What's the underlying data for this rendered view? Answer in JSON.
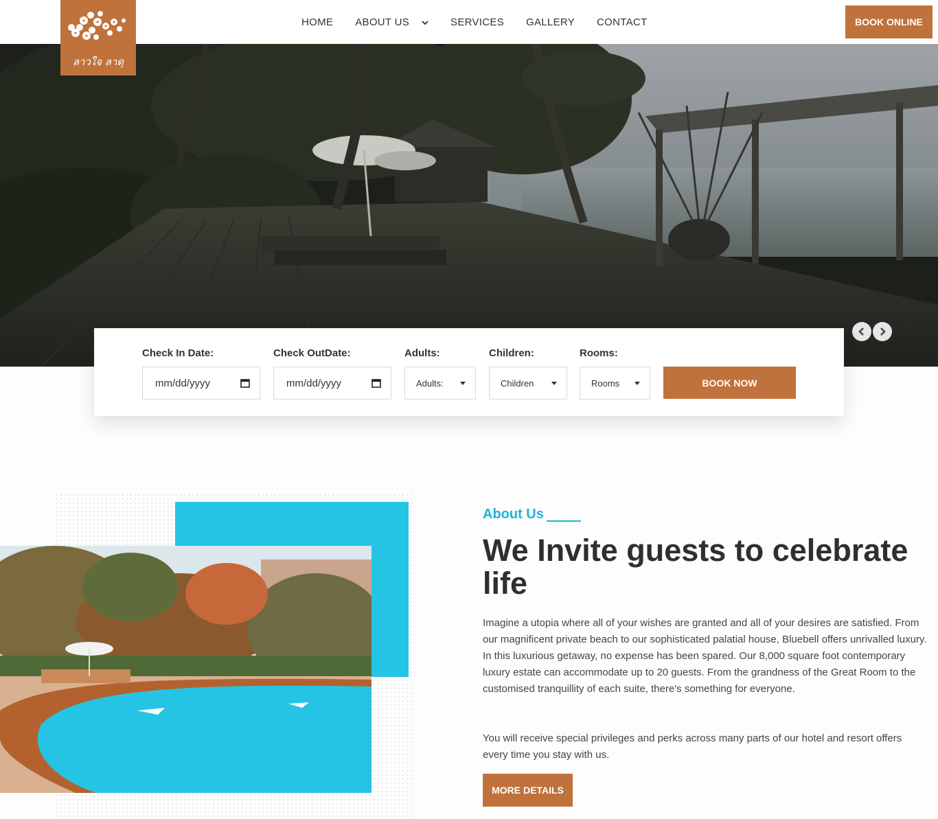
{
  "header": {
    "logo_text": "ลาวใจ ลาดุ",
    "nav": [
      "HOME",
      "ABOUT US",
      "SERVICES",
      "GALLERY",
      "CONTACT"
    ],
    "book_online": "BOOK ONLINE"
  },
  "hero": {
    "prev_icon": "chevron-left-icon",
    "next_icon": "chevron-right-icon"
  },
  "booking": {
    "check_in_label": "Check In Date:",
    "check_in_value": "mm/dd/yyyy",
    "check_out_label": "Check OutDate:",
    "check_out_value": "mm/dd/yyyy",
    "adults_label": "Adults:",
    "adults_value": "Adults:",
    "children_label": "Children:",
    "children_value": "Children",
    "rooms_label": "Rooms:",
    "rooms_value": "Rooms",
    "book_now": "BOOK NOW"
  },
  "about": {
    "kicker": "About Us",
    "title": "We Invite guests to celebrate life",
    "paragraph1": "Imagine a utopia where all of your wishes are granted and all of your desires are satisfied. From our magnificent private beach to our sophisticated palatial house, Bluebell offers unrivalled luxury. In this luxurious getaway, no expense has been spared. Our 8,000 square foot contemporary luxury estate can accommodate up to 20 guests. From the grandness of the Great Room to the customised tranquillity of each suite, there's something for everyone.",
    "paragraph2": "You will receive special privileges and perks across many parts of our hotel and resort offers every time you stay with us.",
    "more_details": "MORE DETAILS"
  },
  "colors": {
    "brand": "#c0723c",
    "accent": "#25c4e4",
    "text_dark": "#2d302c"
  }
}
